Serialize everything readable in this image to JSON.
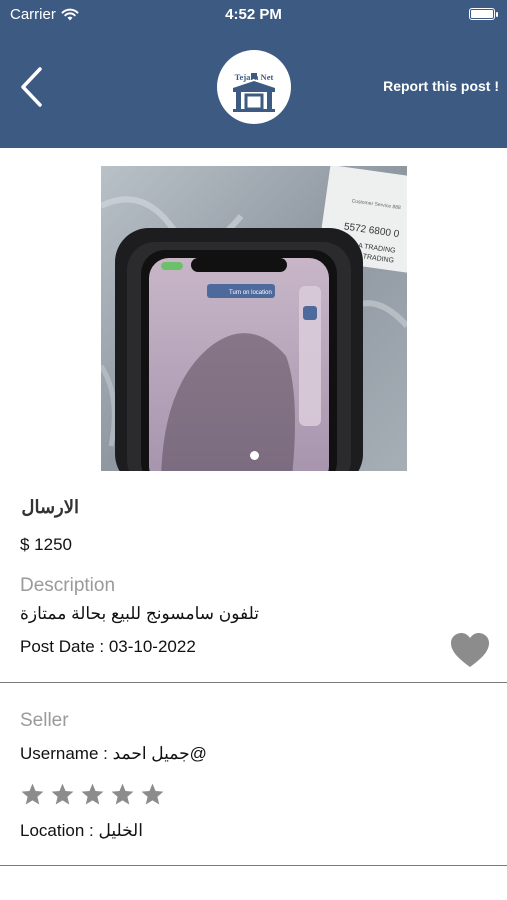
{
  "status_bar": {
    "carrier": "Carrier",
    "time": "4:52 PM"
  },
  "header": {
    "logo_text": "Tejara Net",
    "report_label": "Report this post !",
    "background_color": "#3d5a82"
  },
  "post": {
    "title": "الارسال",
    "price": "$ 1250",
    "description_label": "Description",
    "description": "تلفون سامسونج للبيع بحالة ممتازة",
    "post_date": "Post Date : 03-10-2022",
    "image_count": 1,
    "current_image": 1
  },
  "seller": {
    "section_label": "Seller",
    "username": "Username : جميل احمد@",
    "rating": 0,
    "rating_max": 5,
    "location": "Location : الخليل"
  },
  "photo_card": {
    "card_number": "5572 6800 0",
    "card_line1": "VALLA TRADING",
    "card_line2": "VALLA TRADING",
    "screen_popup": "Turn on location"
  },
  "icons": {
    "back": "chevron-left-icon",
    "favorite": "heart-icon",
    "star": "star-icon",
    "wifi": "wifi-icon",
    "battery": "battery-icon"
  },
  "colors": {
    "accent": "#3d5a82",
    "muted_text": "#9a9a9a",
    "icon_gray": "#8c8c8c"
  }
}
